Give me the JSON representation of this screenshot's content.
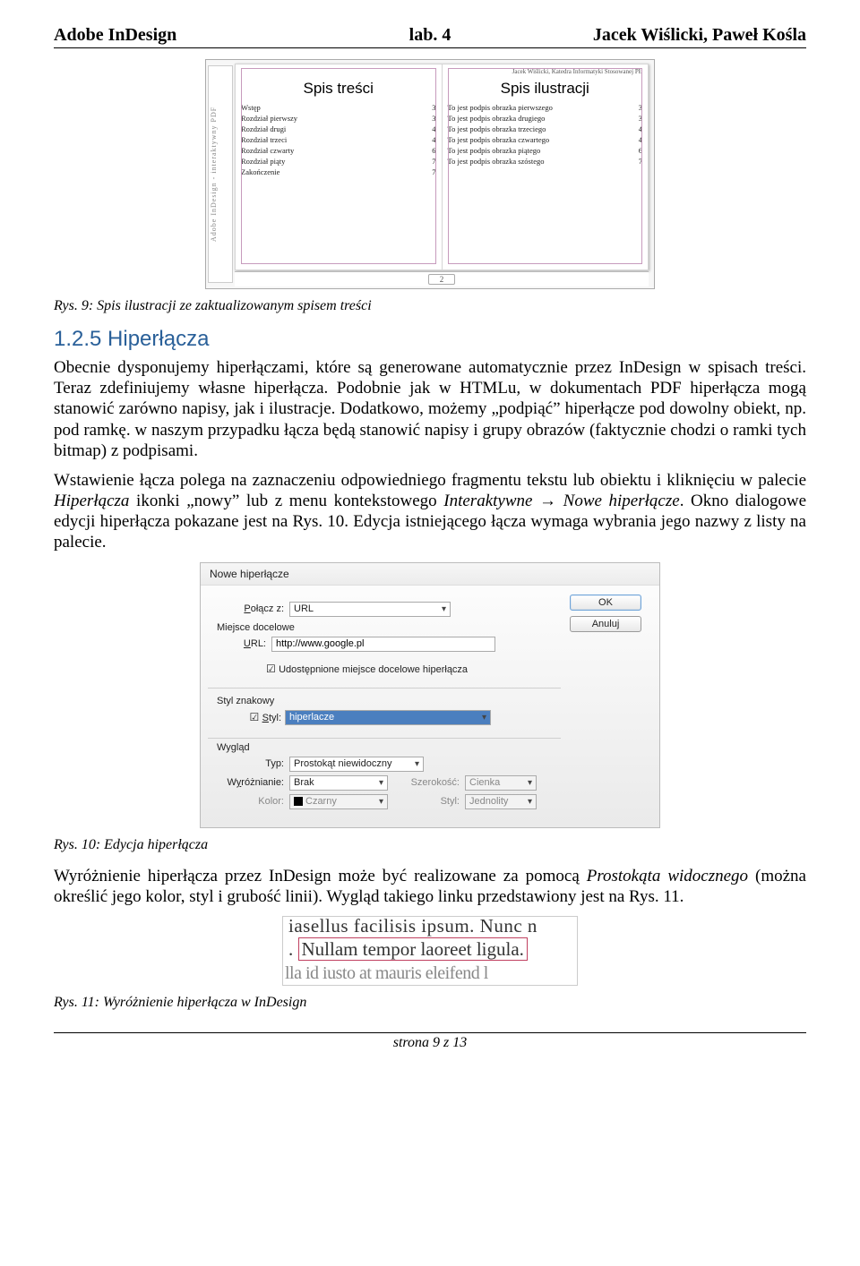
{
  "header": {
    "left": "Adobe InDesign",
    "mid": "lab. 4",
    "right": "Jacek Wiślicki, Paweł Kośla"
  },
  "fig1": {
    "side": "Adobe InDesign - interaktywny PDF",
    "meta": "Jacek Wiślicki, Katedra Informatyki Stosowanej PŁ",
    "leftTitle": "Spis treści",
    "rightTitle": "Spis ilustracji",
    "left": [
      {
        "t": "Wstęp",
        "p": "3"
      },
      {
        "t": "Rozdział pierwszy",
        "p": "3"
      },
      {
        "t": "Rozdział drugi",
        "p": "4"
      },
      {
        "t": "Rozdział trzeci",
        "p": "4"
      },
      {
        "t": "Rozdział czwarty",
        "p": "6"
      },
      {
        "t": "Rozdział piąty",
        "p": "7"
      },
      {
        "t": "Zakończenie",
        "p": "7"
      }
    ],
    "right": [
      {
        "t": "To jest podpis obrazka pierwszego",
        "p": "3"
      },
      {
        "t": "To jest podpis obrazka drugiego",
        "p": "3"
      },
      {
        "t": "To jest podpis obrazka trzeciego",
        "p": "4"
      },
      {
        "t": "To jest podpis obrazka czwartego",
        "p": "4"
      },
      {
        "t": "To jest podpis obrazka piątego",
        "p": "6"
      },
      {
        "t": "To jest podpis obrazka szóstego",
        "p": "7"
      }
    ],
    "pageNo": "2"
  },
  "caption1": "Rys. 9: Spis ilustracji ze zaktualizowanym spisem treści",
  "h2": "1.2.5 Hiperłącza",
  "p1a": "Obecnie dysponujemy hiperłączami, które są generowane automatycznie przez InDesign w spisach treści. Teraz zdefiniujemy własne hiperłącza. Podobnie jak w HTMLu, w dokumentach PDF hiperłącza mogą stanowić zarówno napisy, jak i ilustracje. Dodatkowo, możemy „podpiąć” hiperłącze pod dowolny obiekt, np. pod ramkę. w naszym przypadku łącza będą stanowić napisy i grupy obrazów (faktycznie chodzi o ramki tych bitmap) z podpisami.",
  "p2a": "Wstawienie łącza polega na zaznaczeniu odpowiedniego fragmentu tekstu lub obiektu i kliknięciu w palecie ",
  "p2b": "Hiperłącza",
  "p2c": " ikonki „nowy” lub z menu kontekstowego ",
  "p2d": "Interaktywne → Nowe hiperłącze",
  "p2e": ". Okno dialogowe edycji hiperłącza pokazane jest na Rys. 10. Edycja istniejącego łącza wymaga wybrania jego nazwy z listy na palecie.",
  "dlg": {
    "title": "Nowe hiperłącze",
    "ok": "OK",
    "cancel": "Anuluj",
    "linktoLabel": "Połącz z:",
    "linkto": "URL",
    "destHdr": "Miejsce docelowe",
    "urlLabel": "URL:",
    "url": "http://www.google.pl",
    "share": "Udostępnione miejsce docelowe hiperłącza",
    "charHdr": "Styl znakowy",
    "styleLabel": "Styl:",
    "style": "hiperlacze",
    "lookHdr": "Wygląd",
    "typeLabel": "Typ:",
    "type": "Prostokąt niewidoczny",
    "hlLabel": "Wyróżnianie:",
    "hl": "Brak",
    "widthLabel": "Szerokość:",
    "width": "Cienka",
    "colorLabel": "Kolor:",
    "color": "Czarny",
    "ruleLabel": "Styl:",
    "rule": "Jednolity"
  },
  "caption2": "Rys. 10: Edycja hiperłącza",
  "p3a": "Wyróżnienie hiperłącza przez InDesign może być realizowane za pomocą ",
  "p3b": "Prostokąta widocznego",
  "p3c": " (można określić jego kolor, styl i grubość linii). Wygląd takiego linku przedstawiony jest na Rys. 11.",
  "fig3": {
    "l1": "iasellus facilisis ipsum. Nunc n",
    "l2a": ". ",
    "l2b": "Nullam tempor laoreet ligula.",
    "l3": "lla  id  iusto  at  mauris  eleifend  l"
  },
  "caption3": "Rys. 11: Wyróżnienie hiperłącza w InDesign",
  "footer": "strona 9 z 13"
}
